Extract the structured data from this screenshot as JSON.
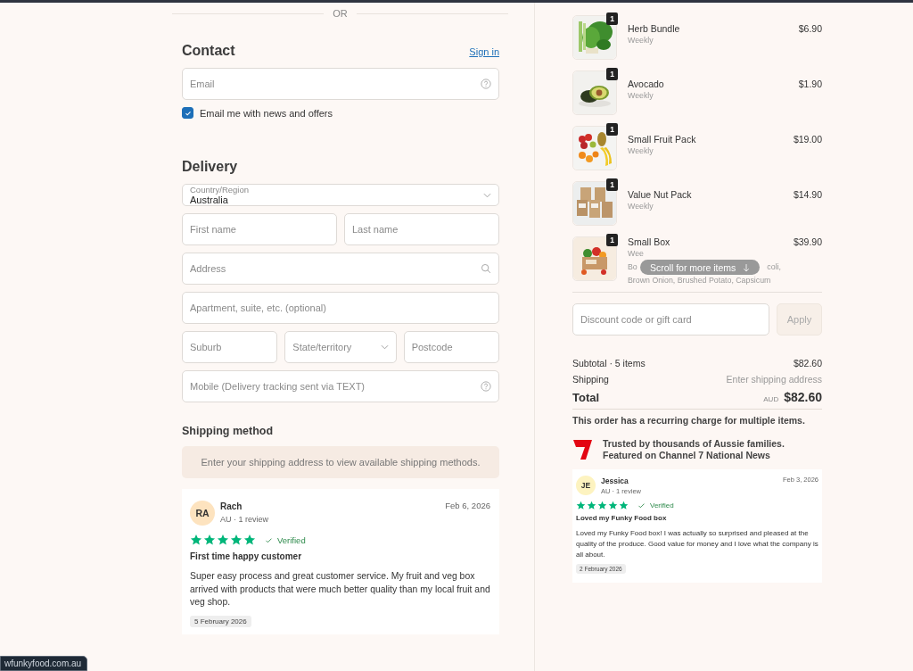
{
  "divider_text": "OR",
  "contact": {
    "heading": "Contact",
    "sign_in": "Sign in",
    "email": {
      "placeholder": "Email"
    },
    "newsletter": {
      "label": "Email me with news and offers",
      "checked": true
    }
  },
  "delivery": {
    "heading": "Delivery",
    "country": {
      "label": "Country/Region",
      "value": "Australia"
    },
    "fields": [
      {
        "kind": "pair",
        "items": [
          {
            "kind": "input",
            "placeholder": "First name"
          },
          {
            "kind": "input",
            "placeholder": "Last name"
          }
        ]
      },
      {
        "kind": "search",
        "placeholder": "Address"
      },
      {
        "kind": "text",
        "placeholder": "Apartment, suite, etc. (optional)"
      },
      {
        "kind": "triple",
        "items": [
          {
            "kind": "input",
            "placeholder": "Suburb"
          },
          {
            "kind": "select",
            "placeholder": "State/territory"
          },
          {
            "kind": "input",
            "placeholder": "Postcode"
          }
        ]
      },
      {
        "kind": "help",
        "placeholder": "Mobile (Delivery tracking sent via TEXT)"
      }
    ]
  },
  "shipping": {
    "heading": "Shipping method",
    "notice": "Enter your shipping address to view available shipping methods."
  },
  "review": {
    "initials": "RA",
    "color": "#fde3bf",
    "name": "Rach",
    "meta": "AU · 1 review",
    "date": "Feb 6, 2026",
    "stars": 5,
    "verified": "Verified",
    "title": "First time happy customer",
    "body": "Super easy process and great customer service. My fruit and veg box arrived with products that were much better quality than my local fruit and veg shop.",
    "tag": "5 February 2026"
  },
  "cart": {
    "items": [
      {
        "kind": "herbs",
        "qty": "1",
        "name": "Herb Bundle",
        "sub": "Weekly",
        "price": "$6.90"
      },
      {
        "kind": "avocado",
        "qty": "1",
        "name": "Avocado",
        "sub": "Weekly",
        "price": "$1.90"
      },
      {
        "kind": "fruit",
        "qty": "1",
        "name": "Small Fruit Pack",
        "sub": "Weekly",
        "price": "$19.00"
      },
      {
        "kind": "nuts",
        "qty": "1",
        "name": "Value Nut Pack",
        "sub": "Weekly",
        "price": "$14.90"
      },
      {
        "kind": "box",
        "qty": "1",
        "name": "Small Box",
        "sub": "Wee",
        "desc_start": "Bo",
        "desc_end": "coli,",
        "desc_line": "Brown Onion, Brushed Potato, Capsicum",
        "price": "$39.90"
      }
    ],
    "scroll_hint": "Scroll for more items",
    "discount": {
      "placeholder": "Discount code or gift card",
      "button": "Apply"
    },
    "subtotal": {
      "label": "Subtotal · 5 items",
      "value": "$82.60"
    },
    "shipping": {
      "label": "Shipping",
      "value": "Enter shipping address"
    },
    "total": {
      "label": "Total",
      "currency": "AUD",
      "value": "$82.60"
    },
    "recurring": "This order has a recurring charge for multiple items.",
    "trust": [
      "Trusted by thousands of Aussie families.",
      "Featured on Channel 7 National News"
    ],
    "review": {
      "initials": "JE",
      "color": "#fdf3c0",
      "name": "Jessica",
      "meta": "AU · 1 review",
      "date": "Feb 3, 2026",
      "stars": 5,
      "verified": "Verified",
      "title": "Loved my Funky Food box",
      "body": "Loved my Funky Food box! I was actually so surprised and pleased at the quality of the produce. Good value for money and I love what the company is all about.",
      "tag": "2 February 2026"
    }
  },
  "link_preview": "wfunkyfood.com.au"
}
